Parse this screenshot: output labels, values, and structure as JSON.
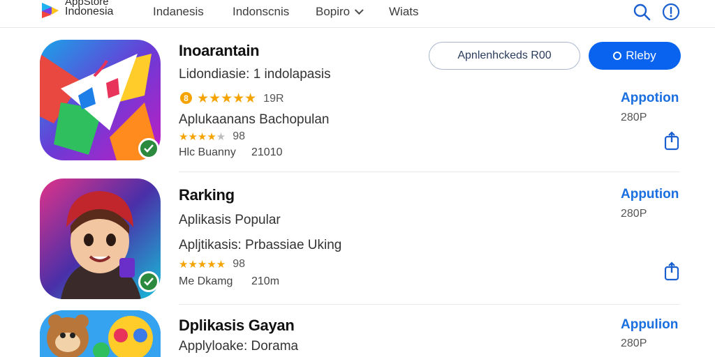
{
  "header": {
    "brand_line1": "AppStore",
    "brand_line2": "Indonesia",
    "nav": [
      {
        "label": "Indanesis"
      },
      {
        "label": "Indonscnis"
      },
      {
        "label": "Bopiro"
      },
      {
        "label": "Wiats"
      }
    ],
    "accent": "#0a63ef"
  },
  "rows": [
    {
      "title": "Inoarantain",
      "subtitle": "Lidondiasie: 1 indolapasis",
      "rating_count": "19R",
      "line3": "Aplukaanans Bachopulan",
      "small_rating_count": "98",
      "meta_label": "Hlc Buanny",
      "meta_value": "21010",
      "outline_button": "Apnlenhckeds R00",
      "primary_button": "Rleby",
      "link": "Appotion",
      "price": "280P"
    },
    {
      "title": "Rarking",
      "subtitle": "Aplikasis Popular",
      "line3": "Apljtikasis: Prbassiae Uking",
      "small_rating_count": "98",
      "meta_label": "Me Dkamg",
      "meta_value": "210m",
      "link": "Appution",
      "price": "280P"
    },
    {
      "title": "Dplikasis Gayan",
      "subtitle": "Applyloake: Dorama",
      "link": "Appulion",
      "price": "280P"
    }
  ],
  "icons": [
    "search-icon",
    "info-icon",
    "share-icon",
    "check-icon",
    "star-icon",
    "chevron-down-icon"
  ]
}
